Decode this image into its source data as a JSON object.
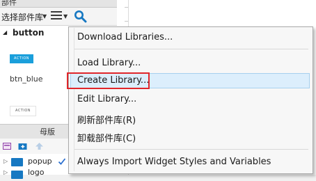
{
  "panel": {
    "header_title": "部件",
    "library_select": "选择部件库",
    "library_name": "button",
    "widgets": [
      {
        "button_text": "ACTION",
        "label": ""
      },
      {
        "button_text": "ACTION",
        "label": "btn_blue"
      }
    ],
    "master_title": "母版",
    "tree": [
      {
        "label": "popup"
      },
      {
        "label": "logo"
      }
    ]
  },
  "menu": {
    "items": [
      {
        "label": "Download Libraries..."
      },
      {
        "label": "Load Library..."
      },
      {
        "label": "Create Library..."
      },
      {
        "label": "Edit Library..."
      },
      {
        "label": "刷新部件库(R)"
      },
      {
        "label": "卸载部件库(C)"
      },
      {
        "label": "Always Import Widget Styles and Variables"
      }
    ]
  },
  "colors": {
    "accent": "#1a9fdb",
    "highlight_border": "#e0262b",
    "hover_bg": "#dceefc",
    "folder": "#1678c2",
    "check": "#2a6fcf"
  }
}
